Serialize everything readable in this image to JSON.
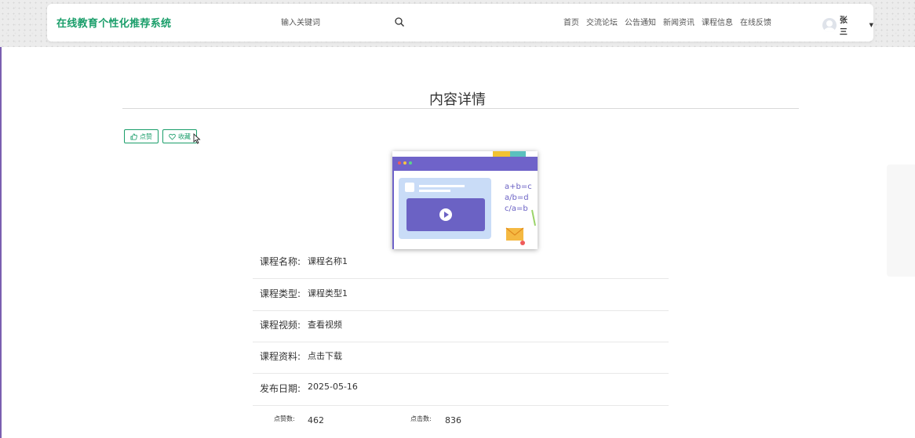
{
  "header": {
    "site_title": "在线教育个性化推荐系统",
    "search_placeholder": "输入关键词",
    "nav": [
      "首页",
      "交流论坛",
      "公告通知",
      "新闻资讯",
      "课程信息",
      "在线反馈"
    ],
    "user_name": "张三"
  },
  "page": {
    "title": "内容详情",
    "like_label": "点赞",
    "favorite_label": "收藏"
  },
  "image_text": {
    "line1": "a+b=c",
    "line2": "a/b=d",
    "line3": "c/a=b"
  },
  "details": [
    {
      "label": "课程名称:",
      "value": "课程名称1"
    },
    {
      "label": "课程类型:",
      "value": "课程类型1"
    },
    {
      "label": "课程视频:",
      "value": "查看视频"
    },
    {
      "label": "课程资料:",
      "value": "点击下载"
    },
    {
      "label": "发布日期:",
      "value": "2025-05-16"
    }
  ],
  "stats": {
    "like_count_label": "点赞数:",
    "like_count": "462",
    "click_count_label": "点击数:",
    "click_count": "836"
  },
  "colors": {
    "accent": "#1a9e6a",
    "edge": "#7a5fb0"
  }
}
